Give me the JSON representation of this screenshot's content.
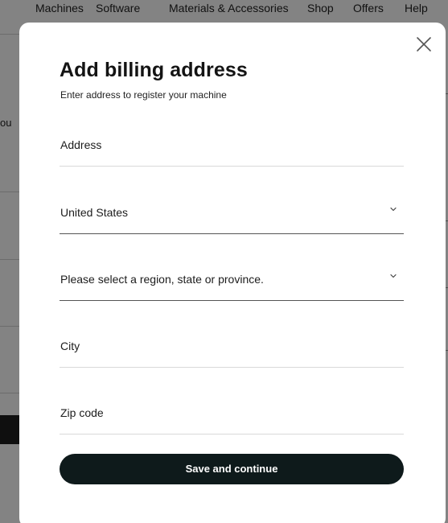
{
  "background": {
    "nav_items": [
      "Machines",
      "Software",
      "Materials & Accessories",
      "Shop",
      "Offers",
      "Help"
    ],
    "stray_text": "ou"
  },
  "modal": {
    "title": "Add billing address",
    "subtitle": "Enter address to register your machine",
    "fields": {
      "address": {
        "placeholder": "Address"
      },
      "country": {
        "value": "United States"
      },
      "region": {
        "placeholder": "Please select a region, state or province."
      },
      "city": {
        "placeholder": "City"
      },
      "zip": {
        "placeholder": "Zip code"
      }
    },
    "save_label": "Save and continue"
  },
  "colors": {
    "button_bg": "#0e1a1b",
    "overlay": "rgba(0,0,0,0.48)"
  }
}
